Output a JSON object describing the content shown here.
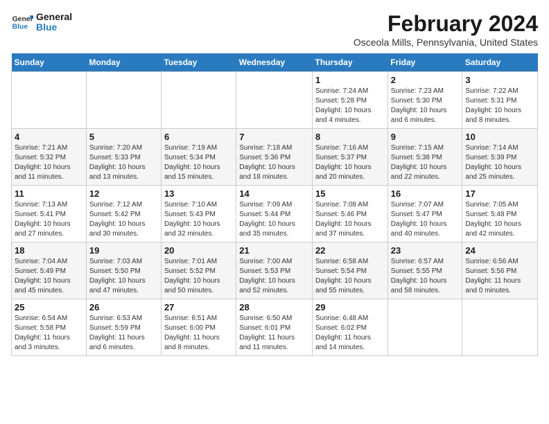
{
  "header": {
    "logo_general": "General",
    "logo_blue": "Blue",
    "title": "February 2024",
    "subtitle": "Osceola Mills, Pennsylvania, United States"
  },
  "days_of_week": [
    "Sunday",
    "Monday",
    "Tuesday",
    "Wednesday",
    "Thursday",
    "Friday",
    "Saturday"
  ],
  "weeks": [
    [
      {
        "day": "",
        "info": ""
      },
      {
        "day": "",
        "info": ""
      },
      {
        "day": "",
        "info": ""
      },
      {
        "day": "",
        "info": ""
      },
      {
        "day": "1",
        "info": "Sunrise: 7:24 AM\nSunset: 5:28 PM\nDaylight: 10 hours\nand 4 minutes."
      },
      {
        "day": "2",
        "info": "Sunrise: 7:23 AM\nSunset: 5:30 PM\nDaylight: 10 hours\nand 6 minutes."
      },
      {
        "day": "3",
        "info": "Sunrise: 7:22 AM\nSunset: 5:31 PM\nDaylight: 10 hours\nand 8 minutes."
      }
    ],
    [
      {
        "day": "4",
        "info": "Sunrise: 7:21 AM\nSunset: 5:32 PM\nDaylight: 10 hours\nand 11 minutes."
      },
      {
        "day": "5",
        "info": "Sunrise: 7:20 AM\nSunset: 5:33 PM\nDaylight: 10 hours\nand 13 minutes."
      },
      {
        "day": "6",
        "info": "Sunrise: 7:19 AM\nSunset: 5:34 PM\nDaylight: 10 hours\nand 15 minutes."
      },
      {
        "day": "7",
        "info": "Sunrise: 7:18 AM\nSunset: 5:36 PM\nDaylight: 10 hours\nand 18 minutes."
      },
      {
        "day": "8",
        "info": "Sunrise: 7:16 AM\nSunset: 5:37 PM\nDaylight: 10 hours\nand 20 minutes."
      },
      {
        "day": "9",
        "info": "Sunrise: 7:15 AM\nSunset: 5:38 PM\nDaylight: 10 hours\nand 22 minutes."
      },
      {
        "day": "10",
        "info": "Sunrise: 7:14 AM\nSunset: 5:39 PM\nDaylight: 10 hours\nand 25 minutes."
      }
    ],
    [
      {
        "day": "11",
        "info": "Sunrise: 7:13 AM\nSunset: 5:41 PM\nDaylight: 10 hours\nand 27 minutes."
      },
      {
        "day": "12",
        "info": "Sunrise: 7:12 AM\nSunset: 5:42 PM\nDaylight: 10 hours\nand 30 minutes."
      },
      {
        "day": "13",
        "info": "Sunrise: 7:10 AM\nSunset: 5:43 PM\nDaylight: 10 hours\nand 32 minutes."
      },
      {
        "day": "14",
        "info": "Sunrise: 7:09 AM\nSunset: 5:44 PM\nDaylight: 10 hours\nand 35 minutes."
      },
      {
        "day": "15",
        "info": "Sunrise: 7:08 AM\nSunset: 5:46 PM\nDaylight: 10 hours\nand 37 minutes."
      },
      {
        "day": "16",
        "info": "Sunrise: 7:07 AM\nSunset: 5:47 PM\nDaylight: 10 hours\nand 40 minutes."
      },
      {
        "day": "17",
        "info": "Sunrise: 7:05 AM\nSunset: 5:48 PM\nDaylight: 10 hours\nand 42 minutes."
      }
    ],
    [
      {
        "day": "18",
        "info": "Sunrise: 7:04 AM\nSunset: 5:49 PM\nDaylight: 10 hours\nand 45 minutes."
      },
      {
        "day": "19",
        "info": "Sunrise: 7:03 AM\nSunset: 5:50 PM\nDaylight: 10 hours\nand 47 minutes."
      },
      {
        "day": "20",
        "info": "Sunrise: 7:01 AM\nSunset: 5:52 PM\nDaylight: 10 hours\nand 50 minutes."
      },
      {
        "day": "21",
        "info": "Sunrise: 7:00 AM\nSunset: 5:53 PM\nDaylight: 10 hours\nand 52 minutes."
      },
      {
        "day": "22",
        "info": "Sunrise: 6:58 AM\nSunset: 5:54 PM\nDaylight: 10 hours\nand 55 minutes."
      },
      {
        "day": "23",
        "info": "Sunrise: 6:57 AM\nSunset: 5:55 PM\nDaylight: 10 hours\nand 58 minutes."
      },
      {
        "day": "24",
        "info": "Sunrise: 6:56 AM\nSunset: 5:56 PM\nDaylight: 11 hours\nand 0 minutes."
      }
    ],
    [
      {
        "day": "25",
        "info": "Sunrise: 6:54 AM\nSunset: 5:58 PM\nDaylight: 11 hours\nand 3 minutes."
      },
      {
        "day": "26",
        "info": "Sunrise: 6:53 AM\nSunset: 5:59 PM\nDaylight: 11 hours\nand 6 minutes."
      },
      {
        "day": "27",
        "info": "Sunrise: 6:51 AM\nSunset: 6:00 PM\nDaylight: 11 hours\nand 8 minutes."
      },
      {
        "day": "28",
        "info": "Sunrise: 6:50 AM\nSunset: 6:01 PM\nDaylight: 11 hours\nand 11 minutes."
      },
      {
        "day": "29",
        "info": "Sunrise: 6:48 AM\nSunset: 6:02 PM\nDaylight: 11 hours\nand 14 minutes."
      },
      {
        "day": "",
        "info": ""
      },
      {
        "day": "",
        "info": ""
      }
    ]
  ]
}
